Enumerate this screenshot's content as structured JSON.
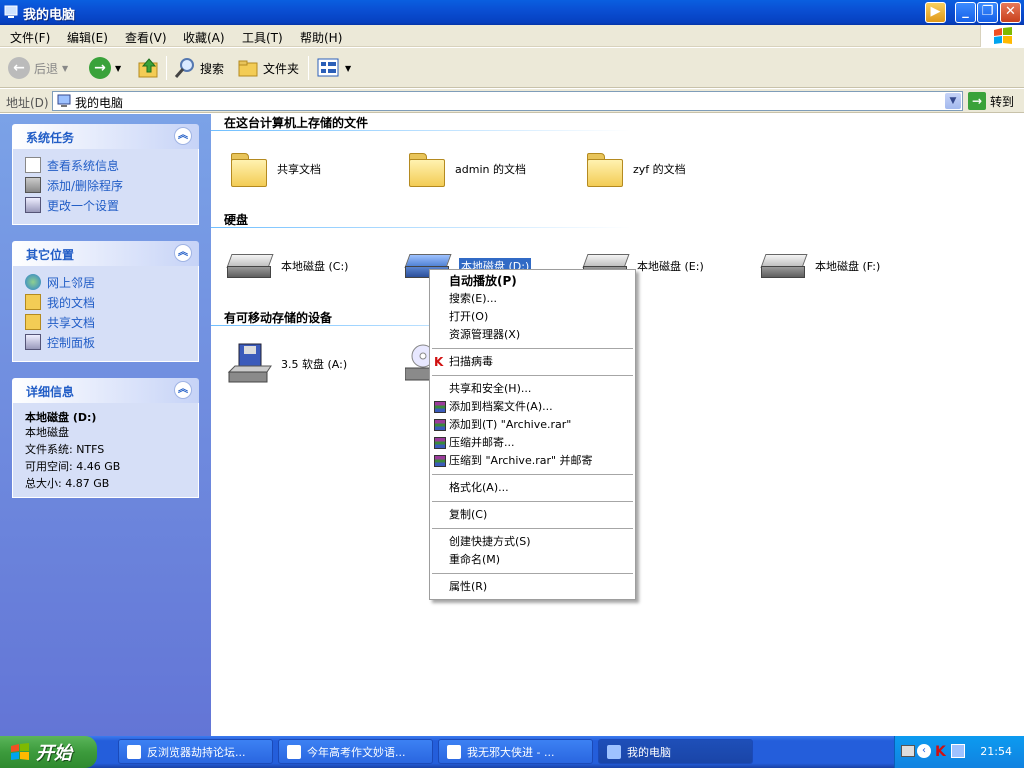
{
  "window": {
    "title": "我的电脑"
  },
  "menu": [
    "文件(F)",
    "编辑(E)",
    "查看(V)",
    "收藏(A)",
    "工具(T)",
    "帮助(H)"
  ],
  "toolbar": {
    "back": "后退",
    "search": "搜索",
    "folders": "文件夹"
  },
  "address": {
    "label": "地址(D)",
    "value": "我的电脑",
    "go": "转到"
  },
  "sidebar": {
    "system_tasks": {
      "title": "系统任务",
      "items": [
        "查看系统信息",
        "添加/删除程序",
        "更改一个设置"
      ]
    },
    "other_places": {
      "title": "其它位置",
      "items": [
        "网上邻居",
        "我的文档",
        "共享文档",
        "控制面板"
      ]
    },
    "details": {
      "title": "详细信息",
      "name": "本地磁盘 (D:)",
      "type": "本地磁盘",
      "fs": "文件系统: NTFS",
      "free": "可用空间: 4.46 GB",
      "total": "总大小: 4.87 GB"
    }
  },
  "groups": {
    "stored": {
      "title": "在这台计算机上存储的文件",
      "items": [
        "共享文档",
        "admin 的文档",
        "zyf 的文档"
      ]
    },
    "hdd": {
      "title": "硬盘",
      "items": [
        "本地磁盘 (C:)",
        "本地磁盘 (D:)",
        "本地磁盘 (E:)",
        "本地磁盘 (F:)"
      ]
    },
    "removable": {
      "title": "有可移动存储的设备",
      "items": [
        "3.5 软盘 (A:)"
      ]
    }
  },
  "context_menu": {
    "autoplay": "自动播放(P)",
    "search": "搜索(E)...",
    "open": "打开(O)",
    "explore": "资源管理器(X)",
    "scan": "扫描病毒",
    "share": "共享和安全(H)...",
    "add_archive": "添加到档案文件(A)...",
    "add_to_rar": "添加到(T) \"Archive.rar\"",
    "compress_mail": "压缩并邮寄...",
    "compress_rar_mail": "压缩到 \"Archive.rar\" 并邮寄",
    "format": "格式化(A)...",
    "copy": "复制(C)",
    "shortcut": "创建快捷方式(S)",
    "rename": "重命名(M)",
    "properties": "属性(R)"
  },
  "taskbar": {
    "start": "开始",
    "tasks": [
      "反浏览器劫持论坛...",
      "今年高考作文妙语...",
      "我无邪大侠进 - ...",
      "我的电脑"
    ],
    "clock": "21:54"
  }
}
